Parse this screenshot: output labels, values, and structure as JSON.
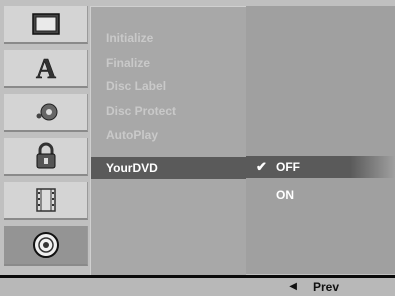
{
  "menu": {
    "items": [
      {
        "label": "Initialize",
        "state": "disabled"
      },
      {
        "label": "Finalize",
        "state": "disabled"
      },
      {
        "label": "Disc Label",
        "state": "disabled"
      },
      {
        "label": "Disc Protect",
        "state": "disabled"
      },
      {
        "label": "AutoPlay",
        "state": "disabled"
      },
      {
        "label": "YourDVD",
        "state": "active"
      }
    ]
  },
  "options": {
    "items": [
      {
        "label": "OFF",
        "selected": true,
        "check": "✔"
      },
      {
        "label": "ON",
        "selected": false
      }
    ]
  },
  "footer": {
    "prev_label": "Prev",
    "prev_icon": "◀"
  },
  "tabs": [
    {
      "icon": "tv-icon",
      "selected": false
    },
    {
      "icon": "language-icon",
      "selected": false
    },
    {
      "icon": "audio-icon",
      "selected": false
    },
    {
      "icon": "lock-icon",
      "selected": false
    },
    {
      "icon": "film-icon",
      "selected": false
    },
    {
      "icon": "disc-icon",
      "selected": true
    }
  ],
  "colors": {
    "panel": "#c0c0c0",
    "active_item": "#5a5a5a",
    "disabled_text": "#c9c9c9"
  }
}
